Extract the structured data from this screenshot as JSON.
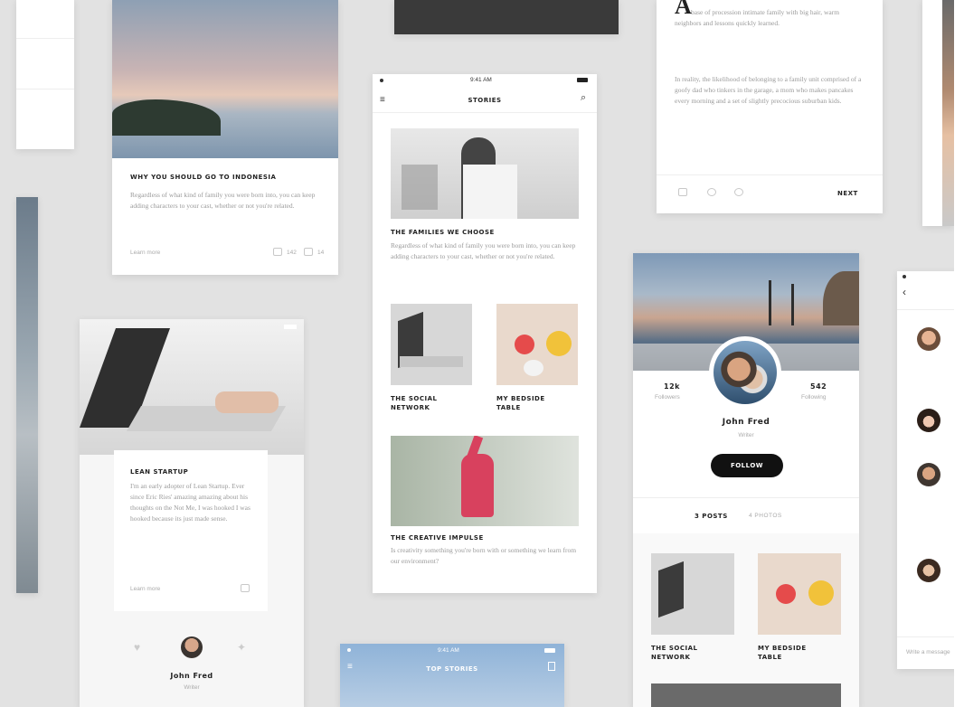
{
  "status": {
    "time": "9:41 AM"
  },
  "story_article": {
    "title": "WHY YOU SHOULD GO TO INDONESIA",
    "body": "Regardless of what kind of family you were born into, you can keep adding characters to your cast, whether or not you're related.",
    "link": "Learn more",
    "likes": "142",
    "comments": "14"
  },
  "stories": {
    "nav_title": "STORIES",
    "featured_title": "THE FAMILIES WE CHOOSE",
    "featured_body": "Regardless of what kind of family you were born into, you can keep adding characters to your cast, whether or not you're related.",
    "tile1": "THE SOCIAL NETWORK",
    "tile2": "MY BEDSIDE TABLE",
    "creative_title": "THE CREATIVE IMPULSE",
    "creative_body": "Is creativity something you're born with or something we learn from our environment?"
  },
  "reading": {
    "para1": "base of procession intimate family with big hair, warm neighbors and lessons quickly learned.",
    "para2": "In reality, the likelihood of belonging to a family unit comprised of a goofy dad who tinkers in the garage, a mom who makes pancakes every morning and a set of slightly precocious suburban kids.",
    "next": "NEXT"
  },
  "startup": {
    "title": "LEAN STARTUP",
    "body": "I'm an early adopter of Lean Startup. Ever since Eric Ries' amazing amazing about his thoughts on the Not Me, I was hooked I was hooked because its just made sense.",
    "link": "Learn more",
    "author": "John Fred",
    "role": "Writer"
  },
  "profile": {
    "followers_count": "12k",
    "followers_label": "Followers",
    "following_count": "542",
    "following_label": "Following",
    "name": "John Fred",
    "role": "Writer",
    "follow_button": "FOLLOW",
    "tab_posts": "3 POSTS",
    "tab_photos": "4 PHOTOS",
    "tile1": "THE SOCIAL NETWORK",
    "tile2": "MY BEDSIDE TABLE"
  },
  "top_stories": {
    "title": "TOP STORIES"
  },
  "chat": {
    "placeholder": "Write a message"
  }
}
